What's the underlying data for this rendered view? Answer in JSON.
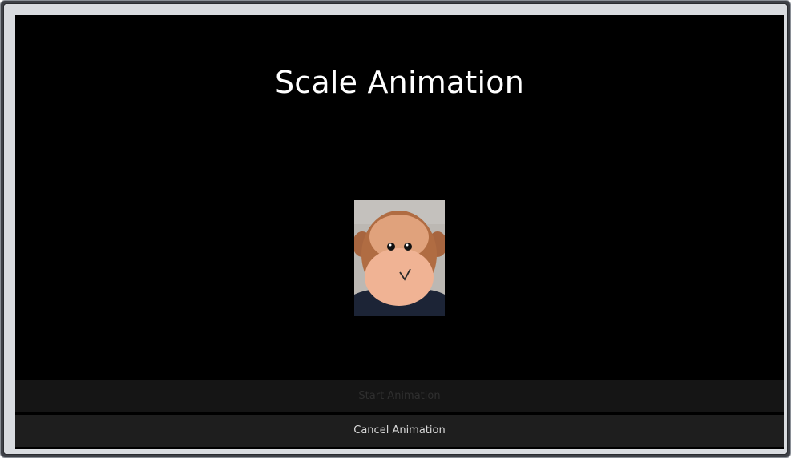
{
  "page": {
    "title": "Scale Animation"
  },
  "image": {
    "subject": "stuffed-monkey-toy"
  },
  "buttons": {
    "start_label": "Start Animation",
    "start_state": "disabled",
    "cancel_label": "Cancel Animation"
  },
  "colors": {
    "background": "#000000",
    "title_text": "#ffffff",
    "start_button_bg": "#151515",
    "start_button_text": "#2f2f2f",
    "cancel_button_bg": "#1e1e1e",
    "cancel_button_text": "#d8d8d8"
  }
}
